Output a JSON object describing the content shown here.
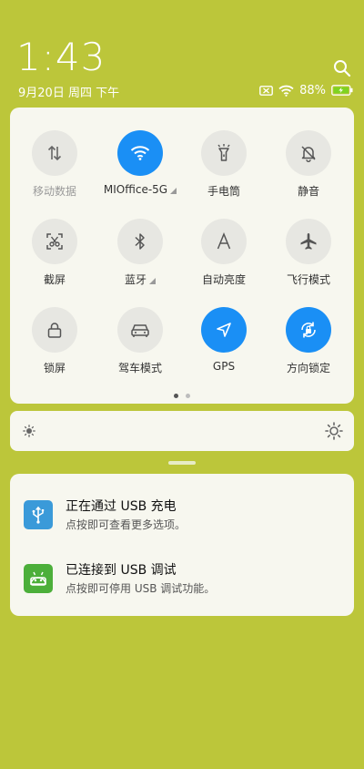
{
  "status_bar": {
    "time": "1:43",
    "date": "9月20日 周四 下午",
    "battery_percent": "88%",
    "icons": [
      "search-icon",
      "no-sim-icon",
      "wifi-icon",
      "battery-charging-icon"
    ],
    "battery_color": "#7ed321"
  },
  "quick_settings": {
    "accent_color": "#1a8ff5",
    "tiles": [
      {
        "label": "移动数据",
        "icon": "mobile-data-icon",
        "active": false,
        "dim": true
      },
      {
        "label": "MIOffice-5G",
        "icon": "wifi-icon",
        "active": true,
        "dim": false,
        "expandable": true
      },
      {
        "label": "手电筒",
        "icon": "flashlight-icon",
        "active": false,
        "dim": false
      },
      {
        "label": "静音",
        "icon": "mute-bell-icon",
        "active": false,
        "dim": false
      },
      {
        "label": "截屏",
        "icon": "screenshot-scissors-icon",
        "active": false,
        "dim": false
      },
      {
        "label": "蓝牙",
        "icon": "bluetooth-icon",
        "active": false,
        "dim": false,
        "expandable": true
      },
      {
        "label": "自动亮度",
        "icon": "auto-brightness-icon",
        "active": false,
        "dim": false
      },
      {
        "label": "飞行模式",
        "icon": "airplane-icon",
        "active": false,
        "dim": false
      },
      {
        "label": "锁屏",
        "icon": "lock-icon",
        "active": false,
        "dim": false
      },
      {
        "label": "驾车模式",
        "icon": "car-icon",
        "active": false,
        "dim": false
      },
      {
        "label": "GPS",
        "icon": "location-arrow-icon",
        "active": true,
        "dim": false
      },
      {
        "label": "方向锁定",
        "icon": "rotation-lock-icon",
        "active": true,
        "dim": false
      }
    ],
    "page_indicator": {
      "current": 1,
      "total": 2
    }
  },
  "brightness": {
    "icons": [
      "brightness-low-icon",
      "brightness-high-icon"
    ]
  },
  "notifications": [
    {
      "title": "正在通过 USB 充电",
      "body": "点按即可查看更多选项。",
      "icon": "usb-icon",
      "icon_color": "#3a9ad9"
    },
    {
      "title": "已连接到 USB 调试",
      "body": "点按即可停用 USB 调试功能。",
      "icon": "android-debug-icon",
      "icon_color": "#4caf3a"
    }
  ]
}
